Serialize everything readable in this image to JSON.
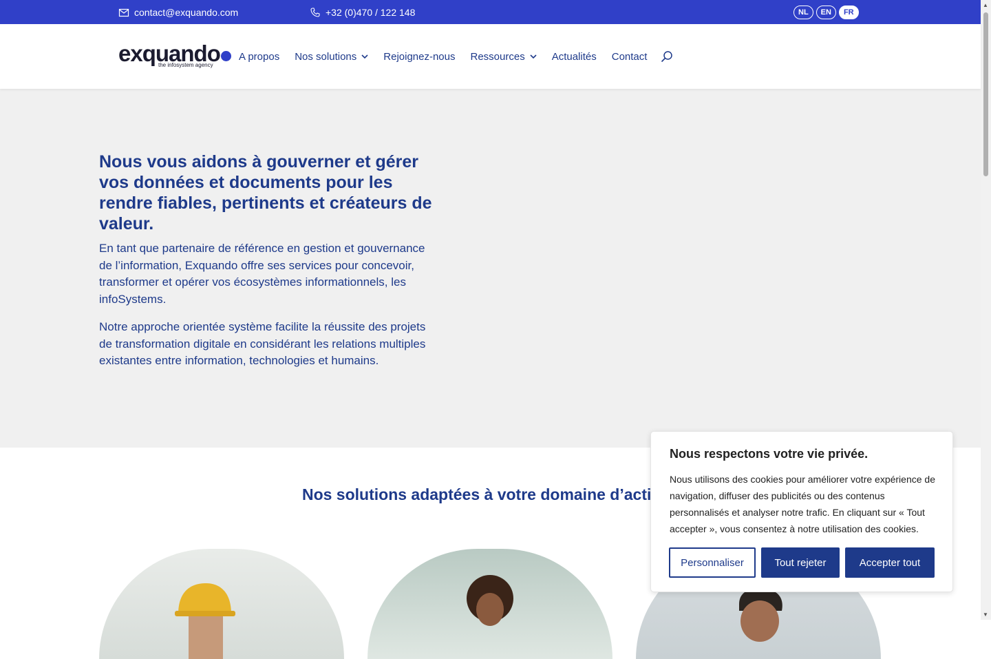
{
  "topbar": {
    "email": "contact@exquando.com",
    "phone": "+32 (0)470 / 122 148",
    "languages": [
      "NL",
      "EN",
      "FR"
    ],
    "active_language": "FR"
  },
  "header": {
    "logo_text": "exquando",
    "logo_tagline": "the infosystem agency",
    "nav": [
      {
        "label": "A propos",
        "has_dropdown": false
      },
      {
        "label": "Nos solutions",
        "has_dropdown": true
      },
      {
        "label": "Rejoignez-nous",
        "has_dropdown": false
      },
      {
        "label": "Ressources",
        "has_dropdown": true
      },
      {
        "label": "Actualités",
        "has_dropdown": false
      },
      {
        "label": "Contact",
        "has_dropdown": false
      }
    ]
  },
  "hero": {
    "title": "Nous vous aidons à gouverner et gérer vos données et documents pour les rendre fiables, pertinents et créateurs de valeur.",
    "paragraph1": "En tant que partenaire de référence en gestion et gouvernance de l’information, Exquando offre ses services pour concevoir, transformer et opérer vos écosystèmes informationnels, les infoSystems.",
    "paragraph2": "Notre approche orientée système facilite la réussite des projets de transformation digitale en considérant les relations multiples existantes entre information, technologies et humains."
  },
  "solutions": {
    "title": "Nos solutions adaptées à votre domaine d’activité"
  },
  "cookie_banner": {
    "title": "Nous respectons votre vie privée.",
    "text": "Nous utilisons des cookies pour améliorer votre expérience de navigation, diffuser des publicités ou des contenus personnalisés et analyser notre trafic. En cliquant sur « Tout accepter », vous consentez à notre utilisation des cookies.",
    "customize_label": "Personnaliser",
    "reject_label": "Tout rejeter",
    "accept_label": "Accepter tout"
  },
  "colors": {
    "brand_blue": "#3040c8",
    "text_navy": "#1e3a8a",
    "hero_bg": "#f0f0f0"
  }
}
